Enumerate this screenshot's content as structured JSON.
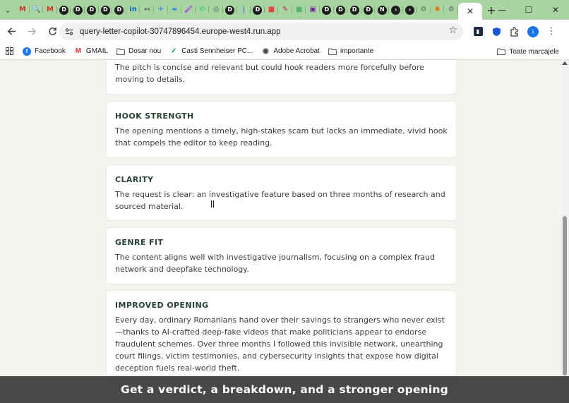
{
  "browser": {
    "tabs": [
      {
        "icon": "gmail-icon",
        "glyph": "M",
        "color": "#d93025"
      },
      {
        "icon": "search-tool-icon",
        "glyph": "🔍",
        "color": "#f29900"
      },
      {
        "icon": "gmail-icon",
        "glyph": "M",
        "color": "#d93025"
      },
      {
        "icon": "d-app-icon",
        "glyph": "D",
        "color": "#1f1f1f"
      },
      {
        "icon": "d-app-icon",
        "glyph": "D",
        "color": "#1f1f1f"
      },
      {
        "icon": "d-app-icon",
        "glyph": "D",
        "color": "#1f1f1f"
      },
      {
        "icon": "d-app-icon",
        "glyph": "D",
        "color": "#1f1f1f"
      },
      {
        "icon": "d-app-icon",
        "glyph": "D",
        "color": "#1f1f1f"
      },
      {
        "icon": "linkedin-icon",
        "glyph": "in",
        "color": "#0a66c2"
      },
      {
        "icon": "arrow-icon",
        "glyph": "↤",
        "color": "#5f6368"
      },
      {
        "icon": "plane-icon",
        "glyph": "✈",
        "color": "#4285f4"
      },
      {
        "icon": "wave-icon",
        "glyph": "≈",
        "color": "#1a73e8"
      },
      {
        "icon": "paint-icon",
        "glyph": "🖌",
        "color": "#a142f4"
      },
      {
        "icon": "whatsapp-icon",
        "glyph": "✆",
        "color": "#25d366"
      },
      {
        "icon": "target-icon",
        "glyph": "◎",
        "color": "#5f6368"
      },
      {
        "icon": "d-app-icon",
        "glyph": "D",
        "color": "#1f1f1f"
      },
      {
        "icon": "tool-icon",
        "glyph": "❙",
        "color": "#5a8dee"
      },
      {
        "icon": "d-app-icon",
        "glyph": "D",
        "color": "#1f1f1f"
      },
      {
        "icon": "folder-red-icon",
        "glyph": "■",
        "color": "#e8453c"
      },
      {
        "icon": "brush-icon",
        "glyph": "✎",
        "color": "#c2185b"
      },
      {
        "icon": "grid-icon",
        "glyph": "▦",
        "color": "#34a853"
      },
      {
        "icon": "chat-icon",
        "glyph": "▣",
        "color": "#7b1fa2"
      },
      {
        "icon": "d-app-icon",
        "glyph": "D",
        "color": "#1f1f1f"
      },
      {
        "icon": "d-app-icon",
        "glyph": "D",
        "color": "#1f1f1f"
      },
      {
        "icon": "d-app-icon",
        "glyph": "D",
        "color": "#1f1f1f"
      },
      {
        "icon": "d-app-icon",
        "glyph": "D",
        "color": "#1f1f1f"
      },
      {
        "icon": "n-app-icon",
        "glyph": "N",
        "color": "#1f1f1f"
      },
      {
        "icon": "terminal-icon",
        "glyph": "›",
        "color": "#1f1f1f"
      },
      {
        "icon": "terminal-icon",
        "glyph": "›",
        "color": "#1f1f1f"
      },
      {
        "icon": "gear-icon",
        "glyph": "⚙",
        "color": "#5f6368"
      },
      {
        "icon": "spark-icon",
        "glyph": "✺",
        "color": "#e37400"
      },
      {
        "icon": "gear-icon",
        "glyph": "⚙",
        "color": "#5f6368"
      }
    ],
    "active_tab_close": "✕",
    "new_tab": "+",
    "window_controls": {
      "minimize": "—",
      "maximize": "☐",
      "close": "✕"
    },
    "url": "query-letter-copilot-30747896454.europe-west4.run.app",
    "bookmarks": [
      {
        "label": "Facebook",
        "icon": "facebook-icon",
        "glyph": "f",
        "color": "#1877f2"
      },
      {
        "label": "GMAIL",
        "icon": "gmail-icon",
        "glyph": "M",
        "color": "#d93025"
      },
      {
        "label": "Dosar nou",
        "icon": "folder-icon",
        "glyph": "",
        "color": ""
      },
      {
        "label": "Casti Sennheiser PC...",
        "icon": "check-icon",
        "glyph": "✓",
        "color": "#1a9c5b"
      },
      {
        "label": "Adobe Acrobat",
        "icon": "globe-icon",
        "glyph": "◉",
        "color": "#444444"
      },
      {
        "label": "importante",
        "icon": "folder-icon",
        "glyph": "",
        "color": ""
      }
    ],
    "all_bookmarks": "Toate marcajele",
    "profile_initial": "i"
  },
  "cards": [
    {
      "heading": "",
      "text": "The pitch is concise and relevant but could hook readers more forcefully before moving to details."
    },
    {
      "heading": "HOOK STRENGTH",
      "text": "The opening mentions a timely, high-stakes scam but lacks an immediate, vivid hook that compels the editor to keep reading."
    },
    {
      "heading": "CLARITY",
      "text": "The request is clear: an investigative feature based on three months of research and sourced material."
    },
    {
      "heading": "GENRE FIT",
      "text": "The content aligns well with investigative journalism, focusing on a complex fraud network and deepfake technology."
    },
    {
      "heading": "IMPROVED OPENING",
      "text": "Every day, ordinary Romanians hand over their savings to strangers who never exist—thanks to AI-crafted deep-fake videos that make politicians appear to endorse fraudulent schemes. Over three months I followed this invisible network, unearthing court filings, victim testimonies, and cybersecurity insights that expose how digital deception fuels real-world theft."
    }
  ],
  "caption": "Get a verdict, a breakdown, and a stronger opening"
}
